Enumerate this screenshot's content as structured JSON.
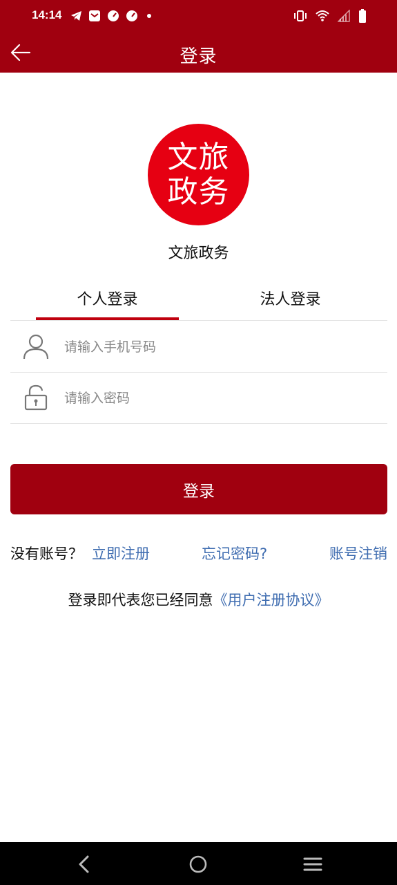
{
  "status_bar": {
    "time": "14:14",
    "left_icons": [
      "telegram-icon",
      "mail-icon",
      "speedometer-icon",
      "speedometer-icon",
      "dot-icon"
    ],
    "right_icons": [
      "vibrate-icon",
      "wifi-icon",
      "signal-icon",
      "battery-icon"
    ]
  },
  "header": {
    "title": "登录",
    "back_icon": "arrow-left-icon"
  },
  "logo": {
    "line1": "文旅",
    "line2": "政务"
  },
  "app_name": "文旅政务",
  "tabs": [
    {
      "label": "个人登录",
      "active": true
    },
    {
      "label": "法人登录",
      "active": false
    }
  ],
  "form": {
    "phone_placeholder": "请输入手机号码",
    "phone_value": "",
    "password_placeholder": "请输入密码",
    "password_value": ""
  },
  "login_button": "登录",
  "links": {
    "no_account": "没有账号？",
    "register": "立即注册",
    "forgot": "忘记密码?",
    "cancel_account": "账号注销"
  },
  "agreement": {
    "text": "登录即代表您已经同意",
    "link": "《用户注册协议》"
  },
  "colors": {
    "primary": "#a0000f",
    "logo": "#e60012",
    "link": "#3e6cb0"
  }
}
